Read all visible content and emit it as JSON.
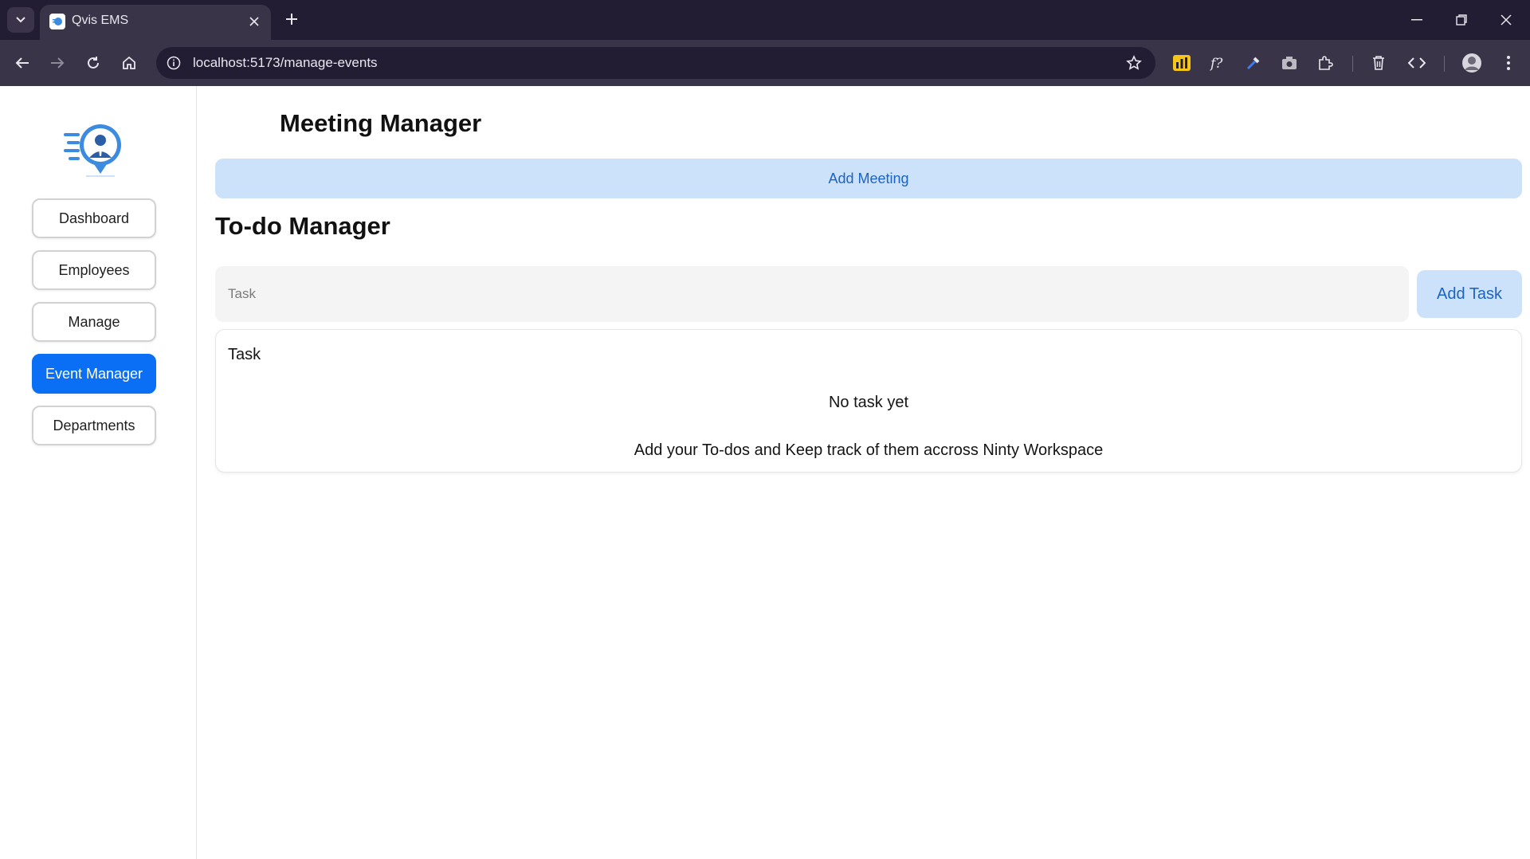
{
  "browser": {
    "tab_title": "Qvis EMS",
    "url": "localhost:5173/manage-events"
  },
  "sidebar": {
    "items": [
      {
        "label": "Dashboard",
        "active": false
      },
      {
        "label": "Employees",
        "active": false
      },
      {
        "label": "Manage",
        "active": false
      },
      {
        "label": "Event Manager",
        "active": true
      },
      {
        "label": "Departments",
        "active": false
      }
    ]
  },
  "meeting": {
    "title": "Meeting Manager",
    "add_button": "Add Meeting"
  },
  "todo": {
    "title": "To-do Manager",
    "input_placeholder": "Task",
    "add_button": "Add Task",
    "list_header": "Task",
    "empty_title": "No task yet",
    "empty_subtitle": "Add your To-dos and Keep track of them accross Ninty Workspace"
  },
  "colors": {
    "accent": "#0b6ff5",
    "soft_button": "#cce1fa",
    "chrome_dark": "#231d33"
  }
}
